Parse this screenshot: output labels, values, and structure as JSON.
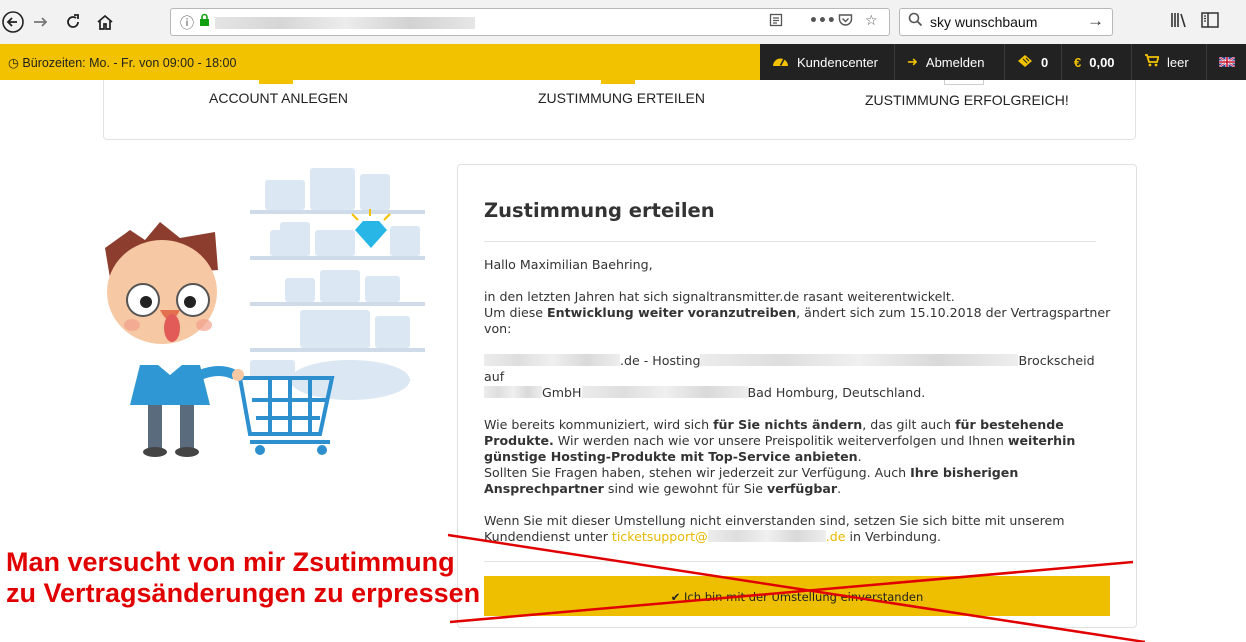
{
  "browser": {
    "search_query": "sky wunschbaum",
    "icons": [
      "back-icon",
      "forward-icon",
      "reload-icon",
      "home-icon",
      "info-icon",
      "lock-icon",
      "reader-icon",
      "more-icon",
      "pocket-icon",
      "bookmark-star-icon",
      "search-icon",
      "go-arrow-icon",
      "library-icon",
      "sidebar-icon"
    ]
  },
  "topbar": {
    "hours": "Bürozeiten: Mo. - Fr. von 09:00 - 18:00",
    "customer_center": "Kundencenter",
    "logout": "Abmelden",
    "tickets": "0",
    "balance": "0,00",
    "cart": "leer",
    "accent_color": "#f2c200"
  },
  "steps": {
    "step1": "ACCOUNT ANLEGEN",
    "step2": "ZUSTIMMUNG ERTEILEN",
    "step3": "ZUSTIMMUNG ERFOLGREICH!"
  },
  "card": {
    "title": "Zustimmung erteilen",
    "greeting": "Hallo Maximilian Baehring,",
    "p1_line1": "in den letzten Jahren hat sich signaltransmitter.de rasant weiterentwickelt.",
    "p1_a": "Um diese ",
    "p1_b": "Entwicklung weiter voranzutreiben",
    "p1_c": ", ändert sich zum 15.10.2018 der Vertragspartner von:",
    "p2_a": ".de - Hosting",
    "p2_b": "Brockscheid",
    "p2_c": "auf",
    "p2_d": "GmbH",
    "p2_e": "Bad Homburg, Deutschland.",
    "p3_a": "Wie bereits kommuniziert, wird sich ",
    "p3_b": "für Sie nichts ändern",
    "p3_c": ", das gilt auch ",
    "p3_d": "für bestehende Produkte.",
    "p3_e": " Wir werden nach wie vor unsere Preispolitik weiterverfolgen und Ihnen ",
    "p3_f": "weiterhin günstige Hosting-Produkte mit Top-Service anbieten",
    "p3_g": ".",
    "p4_a": "Sollten Sie Fragen haben, stehen wir jederzeit zur Verfügung. Auch ",
    "p4_b": "Ihre bisherigen Ansprechpartner",
    "p4_c": " sind wie gewohnt für Sie ",
    "p4_d": "verfügbar",
    "p4_e": ".",
    "p5_a": "Wenn Sie mit dieser Umstellung nicht einverstanden sind, setzen Sie sich bitte mit unserem Kundendienst unter ",
    "p5_link_a": "ticketsupport@",
    "p5_link_b": ".de",
    "p5_c": " in Verbindung.",
    "agree_button": "Ich bin mit der Umstellung einverstanden"
  },
  "annotation": {
    "line1": "Man versucht von mir Zsutimmung",
    "line2": "zu Vertragsänderungen zu erpressen",
    "color": "#e10000"
  }
}
